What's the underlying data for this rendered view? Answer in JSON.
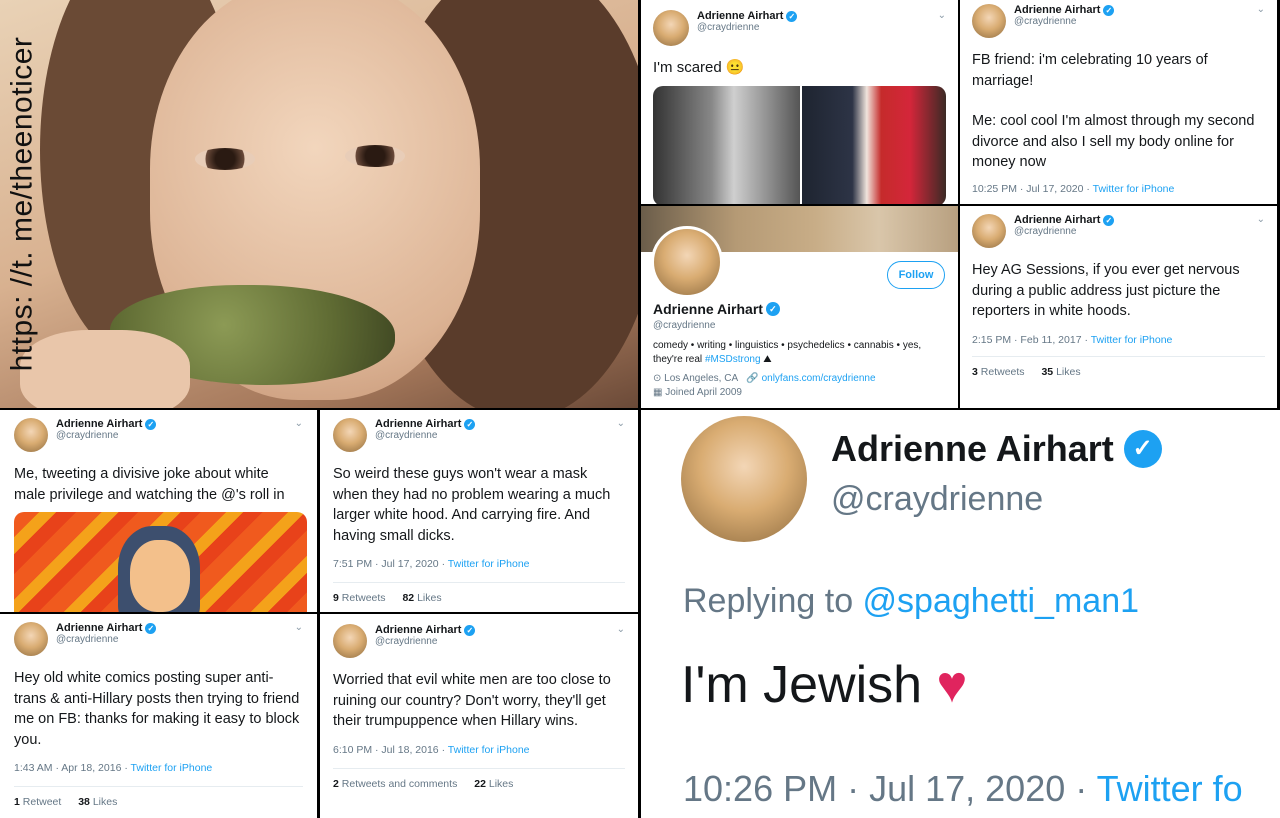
{
  "user": {
    "name": "Adrienne Airhart",
    "handle": "@craydrienne"
  },
  "watermark": "https: //t. me/theenoticer",
  "tweet_scared": {
    "text": "I'm scared 😐"
  },
  "tweet_fb": {
    "text1": "FB friend: i'm celebrating 10 years of marriage!",
    "text2": "Me: cool cool I'm almost through my second divorce and also I sell my body online for money now",
    "time": "10:25 PM · Jul 17, 2020 · ",
    "source": "Twitter for iPhone"
  },
  "profile": {
    "follow": "Follow",
    "bio": "comedy • writing • linguistics • psychedelics • cannabis • yes, they're real ",
    "hashtag": "#MSDstrong",
    "location": "Los Angeles, CA",
    "website": "onlyfans.com/craydrienne",
    "joined": "Joined April 2009"
  },
  "tweet_sessions": {
    "text": "Hey AG Sessions, if you ever get nervous during a public address just picture the reporters in white hoods.",
    "time": "2:15 PM · Feb 11, 2017 · ",
    "source": "Twitter for iPhone",
    "retweets": "3",
    "retweets_label": "Retweets",
    "likes": "35",
    "likes_label": "Likes"
  },
  "tweet_privilege": {
    "text": "Me, tweeting a divisive joke about white male privilege and watching the @'s roll in"
  },
  "tweet_mask": {
    "text": "So weird these guys won't wear a mask when they had no problem wearing a much larger white hood. And carrying fire. And having small dicks.",
    "time": "7:51 PM · Jul 17, 2020 · ",
    "source": "Twitter for iPhone",
    "retweets": "9",
    "retweets_label": "Retweets",
    "likes": "82",
    "likes_label": "Likes"
  },
  "tweet_comics": {
    "text": "Hey old white comics posting super anti-trans & anti-Hillary posts then trying to friend me on FB: thanks for making it easy to block you.",
    "time": "1:43 AM · Apr 18, 2016 · ",
    "source": "Twitter for iPhone",
    "retweets": "1",
    "retweets_label": "Retweet",
    "likes": "38",
    "likes_label": "Likes"
  },
  "tweet_worried": {
    "text": "Worried that evil white men are too close to ruining our country? Don't worry, they'll get their trumpuppence when Hillary wins.",
    "time": "6:10 PM · Jul 18, 2016 · ",
    "source": "Twitter for iPhone",
    "retweets": "2",
    "retweets_label": "Retweets and comments",
    "likes": "22",
    "likes_label": "Likes"
  },
  "tweet_jewish": {
    "replying": "Replying to ",
    "reply_handle": "@spaghetti_man1",
    "text": "I'm Jewish",
    "heart": "♥",
    "time": "10:26 PM · Jul 17, 2020 · ",
    "source": "Twitter fo"
  },
  "colors": {
    "accent": "#1da1f2",
    "heart": "#e0245e"
  }
}
